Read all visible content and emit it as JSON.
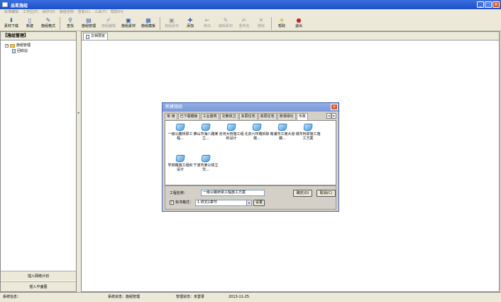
{
  "window": {
    "title": "品茗施组"
  },
  "menu": [
    "标准编辑",
    "工作区(F)",
    "操作(O)",
    "施组范例",
    "查看(C)",
    "工具(T)",
    "帮助(H)"
  ],
  "toolbar": [
    {
      "label": "素材下载",
      "icon": "download-icon",
      "enabled": true
    },
    {
      "label": "新建",
      "icon": "new-doc-icon",
      "enabled": true
    },
    {
      "label": "施组格式",
      "icon": "format-icon",
      "enabled": true
    },
    {
      "label": "查找",
      "icon": "binoculars-icon",
      "enabled": true
    },
    {
      "label": "施组管理",
      "icon": "manage-icon",
      "enabled": true
    },
    {
      "label": "施组编辑",
      "icon": "edit-icon",
      "enabled": false
    },
    {
      "label": "施组素材",
      "icon": "material-icon",
      "enabled": true
    },
    {
      "label": "施组模板",
      "icon": "template-icon",
      "enabled": true
    },
    {
      "label": "施组素材",
      "icon": "material-icon",
      "enabled": false
    },
    {
      "label": "添加",
      "icon": "add-icon",
      "enabled": true
    },
    {
      "label": "移出",
      "icon": "remove-icon",
      "enabled": false
    },
    {
      "label": "编辑素材",
      "icon": "edit-material-icon",
      "enabled": false
    },
    {
      "label": "重命名",
      "icon": "rename-icon",
      "enabled": false
    },
    {
      "label": "删除",
      "icon": "delete-icon",
      "enabled": false
    },
    {
      "label": "帮助",
      "icon": "help-icon",
      "enabled": true
    },
    {
      "label": "退出",
      "icon": "exit-icon",
      "enabled": true
    }
  ],
  "left_panel": {
    "title": "【施组管理】",
    "tree_root": "施组管理",
    "tree_child": "回收站",
    "buttons": [
      "插入网络计划",
      "插入平面图"
    ]
  },
  "main": {
    "tab": "文档预览"
  },
  "status": {
    "info": "系统信息：",
    "system_state": "系统状态：施组管理",
    "manage_state": "管理状态：未登录",
    "date": "2013-11-25"
  },
  "dialog": {
    "title": "新建施组",
    "tabs": [
      "常  用",
      "已下载模板",
      "工业建筑",
      "文教体卫",
      "多层住宅",
      "高层住宅",
      "景观绿化",
      "市政"
    ],
    "active_tab": 7,
    "templates": [
      "一级公路桥梁工程...",
      "佛山市海八路某立...",
      "沧河大桥施工组织设计",
      "北京六环路拆除施...",
      "南浦市江南大道路...",
      "城市桥梁施工施工方案",
      "学府路施工组织设计",
      "宁波市某公铁立交..."
    ],
    "name_label": "工程名称：",
    "name_value": "一级公路桥梁工程施工方案",
    "format_label": "标书格式：",
    "format_checked": true,
    "format_value": "1  样式1章节",
    "settings_label": "设置",
    "ok_label": "确定(O)",
    "cancel_label": "取消(C)"
  }
}
